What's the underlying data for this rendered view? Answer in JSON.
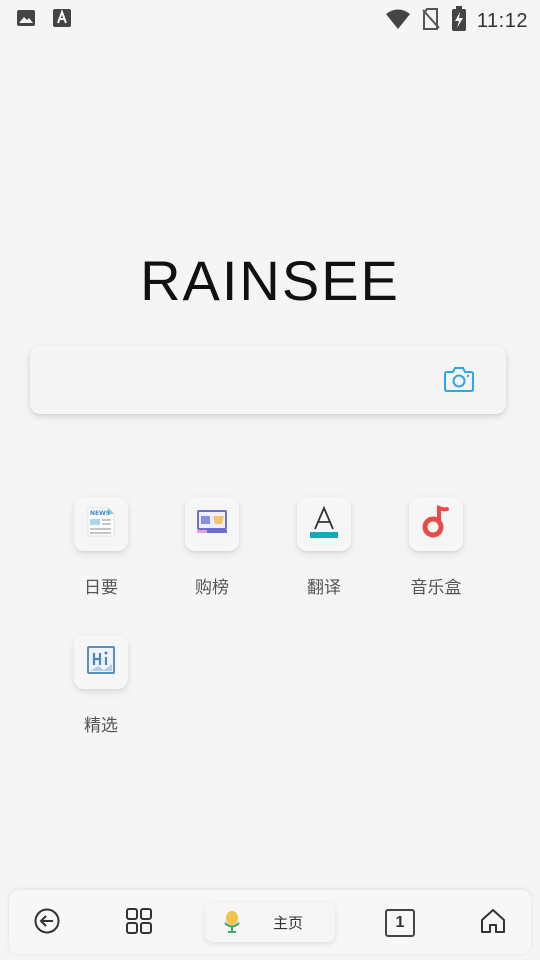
{
  "status_bar": {
    "time": "11:12",
    "icons": [
      "image-notification-icon",
      "font-notification-icon",
      "wifi-icon",
      "no-sim-icon",
      "battery-charging-icon"
    ]
  },
  "logo": {
    "text": "RAINSEE"
  },
  "search": {
    "value": "",
    "placeholder": "",
    "camera_icon": "camera-icon",
    "accent": "#2ba8e6"
  },
  "shortcuts": [
    {
      "label": "日要",
      "icon": "news-icon"
    },
    {
      "label": "购榜",
      "icon": "shopping-rank-icon"
    },
    {
      "label": "翻译",
      "icon": "translate-icon"
    },
    {
      "label": "音乐盒",
      "icon": "music-note-icon"
    },
    {
      "label": "精选",
      "icon": "hi-picks-icon"
    }
  ],
  "bottom_bar": {
    "back_icon": "back-arrow-icon",
    "menu_icon": "grid-menu-icon",
    "home_label": "主页",
    "voice_icon": "microphone-icon",
    "tab_count": "1",
    "home_icon": "house-icon"
  },
  "colors": {
    "background": "#f5f5f5",
    "music_red": "#e94b4b",
    "translate_teal": "#19a9b5",
    "mic_yellow": "#f1c34a",
    "mic_green": "#3aa86a"
  }
}
